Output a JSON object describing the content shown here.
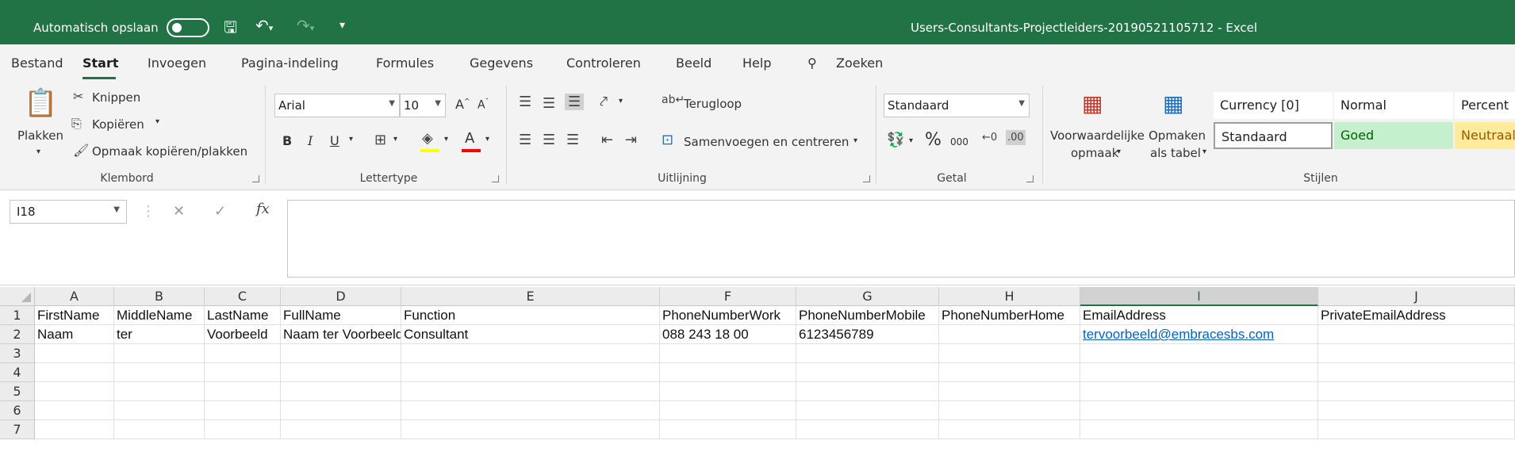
{
  "title_bar": {
    "autosave_label": "Automatisch opslaan",
    "document_title": "Users-Consultants-Projectleiders-20190521105712  -  Excel",
    "color": "#217346"
  },
  "tabs": [
    {
      "label": "Bestand"
    },
    {
      "label": "Start",
      "active": true
    },
    {
      "label": "Invoegen"
    },
    {
      "label": "Pagina-indeling"
    },
    {
      "label": "Formules"
    },
    {
      "label": "Gegevens"
    },
    {
      "label": "Controleren"
    },
    {
      "label": "Beeld"
    },
    {
      "label": "Help"
    }
  ],
  "search": {
    "label": "Zoeken"
  },
  "ribbon": {
    "clipboard": {
      "paste": "Plakken",
      "cut": "Knippen",
      "copy": "Kopiëren",
      "format_painter": "Opmaak kopiëren/plakken",
      "group": "Klembord"
    },
    "font": {
      "name": "Arial",
      "size": "10",
      "bold": "B",
      "italic": "I",
      "underline": "U",
      "color_a": "A",
      "grow": "A",
      "shrink": "A",
      "group": "Lettertype"
    },
    "alignment": {
      "wrap": "Terugloop",
      "merge": "Samenvoegen en centreren",
      "group": "Uitlijning"
    },
    "number": {
      "format": "Standaard",
      "percent": "%",
      "thousands": "000",
      "group": "Getal"
    },
    "styles": {
      "conditional_1": "Voorwaardelijke",
      "conditional_2": "opmaak",
      "table_1": "Opmaken",
      "table_2": "als tabel",
      "row1": [
        "Currency [0]",
        "Normal",
        "Percent"
      ],
      "row2": [
        "Standaard",
        "Goed",
        "Neutraal"
      ],
      "group": "Stijlen"
    }
  },
  "formula_bar": {
    "name_box": "I18",
    "fx": "fx",
    "cancel": "✕",
    "enter": "✓",
    "value": ""
  },
  "grid": {
    "columns": [
      "A",
      "B",
      "C",
      "D",
      "E",
      "F",
      "G",
      "H",
      "I",
      "J"
    ],
    "selected_column": "I",
    "rows": [
      "1",
      "2",
      "3",
      "4",
      "5",
      "6",
      "7"
    ],
    "row1": [
      "FirstName",
      "MiddleName",
      "LastName",
      "FullName",
      "Function",
      "PhoneNumberWork",
      "PhoneNumberMobile",
      "PhoneNumberHome",
      "EmailAddress",
      "PrivateEmailAddress"
    ],
    "row2": [
      "Naam",
      "ter",
      "Voorbeeld",
      "Naam ter Voorbeeld",
      "Consultant",
      "088 243 18 00",
      "6123456789",
      "",
      "tervoorbeeld@embracesbs.com",
      ""
    ]
  }
}
